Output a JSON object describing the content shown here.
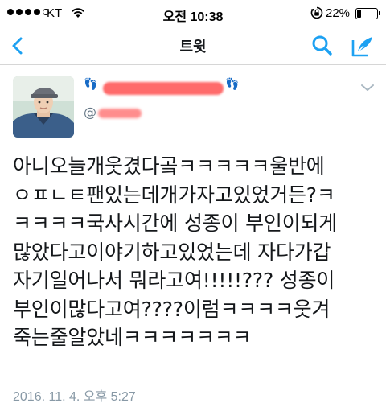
{
  "status_bar": {
    "carrier": "KT",
    "time": "오전 10:38",
    "battery": "22%",
    "battery_level": 0.22,
    "signal_bars_filled": 4,
    "signal_bars_total": 5
  },
  "nav": {
    "title": "트윗",
    "back_icon": "chevron-left-icon",
    "search_icon": "search-icon",
    "compose_icon": "compose-tweet-icon"
  },
  "tweet": {
    "author_emoji_left": "👣",
    "author_emoji_right": "👣",
    "handle_prefix": "@",
    "text": "아니오늘개웃겼다곸ㅋㅋㅋㅋㅋ울반에\nㅇㅍㄴㅌ팬있는데개가자고있었거든?ㅋ\nㅋㅋㅋㅋ국사시간에 성종이 부인이되게\n많았다고이야기하고있었는데 자다가갑\n자기일어나서  뭐라고여!!!!!??? 성종이\n부인이많다고여????이럼ㅋㅋㅋㅋ웃겨\n죽는줄알았네ㅋㅋㅋㅋㅋㅋㅋ",
    "timestamp": "2016. 11. 4. 오후 5:27"
  },
  "colors": {
    "accent": "#1da1f2",
    "timestamp": "#8899a6",
    "redaction": "#ff6b6b"
  }
}
